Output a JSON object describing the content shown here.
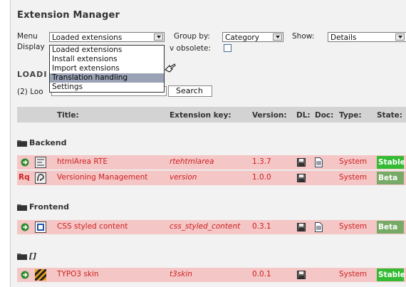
{
  "header": {
    "title": "Extension Manager"
  },
  "controls": {
    "menu_label": "Menu",
    "menu_value": "Loaded extensions",
    "menu_options": [
      "Loaded extensions",
      "Install extensions",
      "Import extensions",
      "Translation handling",
      "Settings"
    ],
    "menu_highlighted_index": 3,
    "group_by_label": "Group by:",
    "group_by_value": "Category",
    "show_label": "Show:",
    "show_value": "Details",
    "display_label_partial": "Display",
    "obsolete_label_partial": "v obsolete:",
    "section_partial": "LOADI",
    "count_partial": "(2) Loo",
    "search_button": "Search",
    "search_value": ""
  },
  "table": {
    "headers": [
      "Title:",
      "Extension key:",
      "Version:",
      "DL:",
      "Doc:",
      "Type:",
      "State:"
    ],
    "groups": [
      {
        "name": "Backend",
        "rows": [
          {
            "title": "htmlArea RTE",
            "key": "rtehtmlarea",
            "version": "1.3.7",
            "has_doc": true,
            "type": "System",
            "state": "Stable",
            "action": "install"
          },
          {
            "title": "Versioning Management",
            "key": "version",
            "version": "1.0.0",
            "has_doc": false,
            "type": "System",
            "state": "Beta",
            "action": "Rq"
          }
        ]
      },
      {
        "name": "Frontend",
        "rows": [
          {
            "title": "CSS styled content",
            "key": "css_styled_content",
            "version": "0.3.1",
            "has_doc": true,
            "type": "System",
            "state": "Beta",
            "action": "install"
          }
        ]
      },
      {
        "name": "[]",
        "rows": [
          {
            "title": "TYPO3 skin",
            "key": "t3skin",
            "version": "0.0.1",
            "has_doc": false,
            "type": "System",
            "state": "Stable",
            "action": "install"
          }
        ]
      }
    ]
  },
  "colors": {
    "row_bg": "#f5c6c6",
    "stable": "#33bb33",
    "beta": "#77aa66",
    "link_red": "#cc2222",
    "highlight": "#9aa2b5"
  }
}
